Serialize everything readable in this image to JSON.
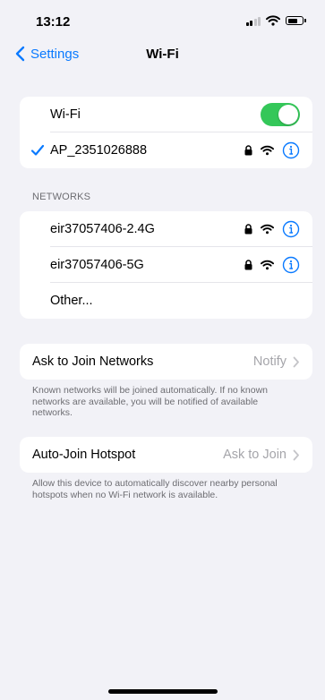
{
  "status_bar": {
    "time": "13:12"
  },
  "nav": {
    "back_label": "Settings",
    "title": "Wi-Fi"
  },
  "wifi_section": {
    "toggle_label": "Wi-Fi",
    "toggle_on": true,
    "connected_network": "AP_2351026888"
  },
  "networks_section": {
    "header": "NETWORKS",
    "items": [
      {
        "name": "eir37057406-2.4G",
        "secured": true
      },
      {
        "name": "eir37057406-5G",
        "secured": true
      }
    ],
    "other_label": "Other..."
  },
  "ask_to_join": {
    "label": "Ask to Join Networks",
    "value": "Notify",
    "footnote": "Known networks will be joined automatically. If no known networks are available, you will be notified of available networks."
  },
  "auto_join_hotspot": {
    "label": "Auto-Join Hotspot",
    "value": "Ask to Join",
    "footnote": "Allow this device to automatically discover nearby personal hotspots when no Wi-Fi network is available."
  },
  "colors": {
    "accent": "#0a7aff",
    "toggle_on": "#34c759",
    "background": "#f2f2f7",
    "secondary_text": "#6d6d72"
  },
  "icons": [
    "chevron-left-icon",
    "checkmark-icon",
    "lock-icon",
    "wifi-icon",
    "info-icon",
    "chevron-right-icon",
    "signal-icon",
    "battery-icon"
  ]
}
